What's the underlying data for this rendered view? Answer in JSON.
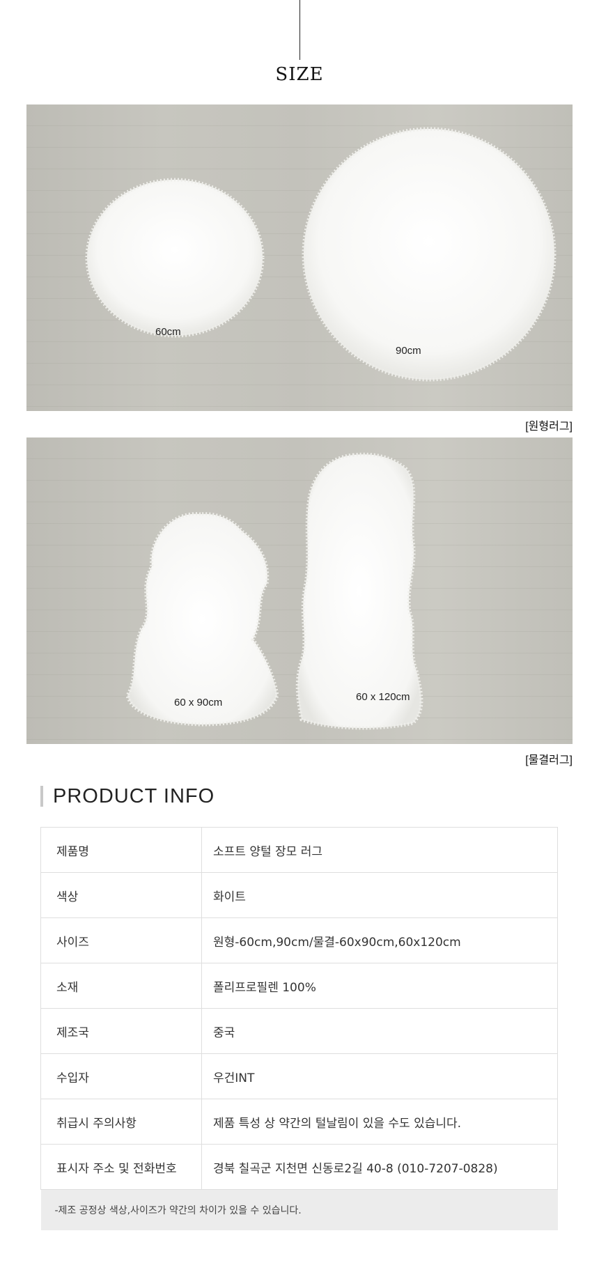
{
  "size_section": {
    "heading": "SIZE",
    "round_rugs": {
      "labels": [
        "60cm",
        "90cm"
      ],
      "caption": "[원형러그]"
    },
    "wave_rugs": {
      "labels": [
        "60 x 90cm",
        "60 x 120cm"
      ],
      "caption": "[물결러그]"
    }
  },
  "product_info": {
    "heading": "PRODUCT INFO",
    "rows": [
      {
        "key": "제품명",
        "value": "소프트 양털 장모 러그"
      },
      {
        "key": "색상",
        "value": "화이트"
      },
      {
        "key": "사이즈",
        "value": "원형-60cm,90cm/물결-60x90cm,60x120cm"
      },
      {
        "key": "소재",
        "value": "폴리프로필렌 100%"
      },
      {
        "key": "제조국",
        "value": "중국"
      },
      {
        "key": "수입자",
        "value": "우건INT"
      },
      {
        "key": "취급시 주의사항",
        "value": "제품 특성 상 약간의 털날림이 있을 수도 있습니다."
      },
      {
        "key": "표시자 주소 및 전화번호",
        "value": "경북 칠곡군 지천면 신동로2길 40-8 (010-7207-0828)"
      }
    ],
    "note": "-제조 공정상 색상,사이즈가 약간의 차이가 있을 수 있습니다."
  }
}
